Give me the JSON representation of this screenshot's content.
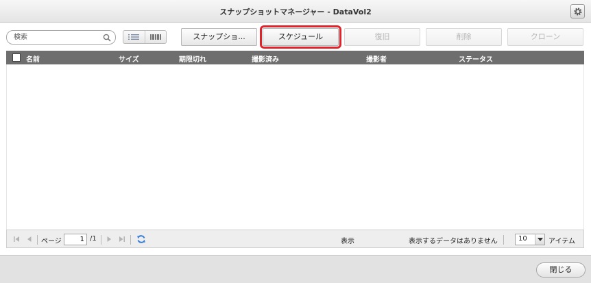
{
  "window": {
    "title": "スナップショットマネージャー - DataVol2"
  },
  "search": {
    "placeholder": "検索"
  },
  "toolbar": {
    "snapshot_label": "スナップショ...",
    "schedule_label": "スケジュール",
    "restore_label": "復旧",
    "delete_label": "削除",
    "clone_label": "クローン"
  },
  "table": {
    "columns": [
      "名前",
      "サイズ",
      "期限切れ",
      "撮影済み",
      "撮影者",
      "ステータス"
    ],
    "rows": []
  },
  "pager": {
    "page_label": "ページ",
    "current_page": "1",
    "total_pages": "/1",
    "display_label": "表示",
    "no_data_text": "表示するデータはありません",
    "page_size": "10",
    "items_label": "アイテム"
  },
  "footer": {
    "close_label": "閉じる"
  },
  "colors": {
    "highlight": "#e0222a",
    "header_bg": "#6e6e6e",
    "refresh": "#3a7fd5"
  },
  "icons": [
    "gear-icon",
    "search-icon",
    "list-view-icon",
    "thumbnail-view-icon",
    "first-page-icon",
    "prev-page-icon",
    "next-page-icon",
    "last-page-icon",
    "refresh-icon",
    "chevron-down-icon"
  ]
}
